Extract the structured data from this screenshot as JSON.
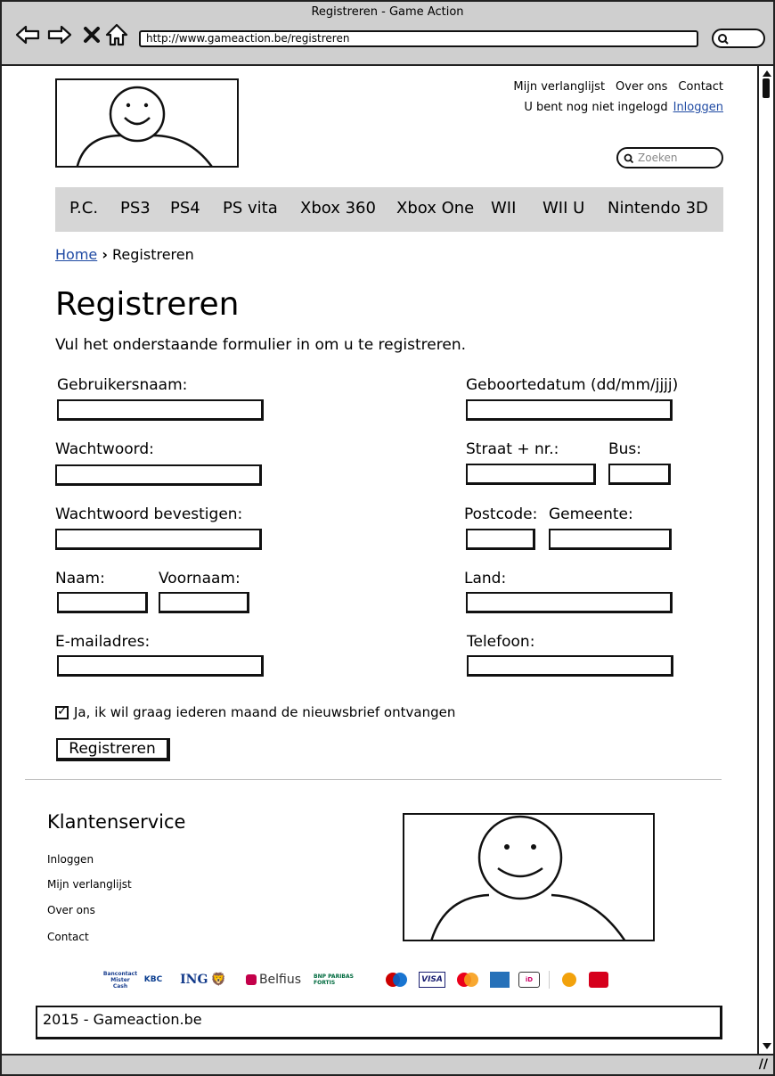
{
  "window": {
    "title": "Registreren - Game Action",
    "url": "http://www.gameaction.be/registreren"
  },
  "header": {
    "links": [
      "Mijn verlanglijst",
      "Over ons",
      "Contact"
    ],
    "login_status": "U bent nog niet ingelogd",
    "login_link": "Inloggen",
    "search_placeholder": "Zoeken"
  },
  "menu": [
    "P.C.",
    "PS3",
    "PS4",
    "PS vita",
    "Xbox 360",
    "Xbox One",
    "WII",
    "WII U",
    "Nintendo 3D"
  ],
  "breadcrumb": {
    "home": "Home",
    "separator": "›",
    "current": "Registreren"
  },
  "page": {
    "title": "Registreren",
    "intro": "Vul het onderstaande formulier in om u te registreren."
  },
  "form": {
    "username": "Gebruikersnaam:",
    "password": "Wachtwoord:",
    "password_confirm": "Wachtwoord bevestigen:",
    "lastname": "Naam:",
    "firstname": "Voornaam:",
    "email": "E-mailadres:",
    "birthdate": "Geboortedatum (dd/mm/jjjj)",
    "street": "Straat + nr.:",
    "bus": "Bus:",
    "postcode": "Postcode:",
    "city": "Gemeente:",
    "country": "Land:",
    "phone": "Telefoon:",
    "newsletter": "Ja, ik wil graag iederen maand de nieuwsbrief ontvangen",
    "newsletter_checked": true,
    "submit": "Registreren"
  },
  "footer": {
    "title": "Klantenservice",
    "links": [
      "Inloggen",
      "Mijn verlanglijst",
      "Over ons",
      "Contact"
    ],
    "payments": [
      "Bancontact Mister Cash",
      "KBC",
      "ING",
      "Belfius",
      "BNP Paribas Fortis",
      "Maestro",
      "VISA",
      "MasterCard",
      "American Express",
      "iDEAL",
      "Bpost",
      "Payconiq"
    ],
    "copyright": "2015 - Gameaction.be"
  }
}
